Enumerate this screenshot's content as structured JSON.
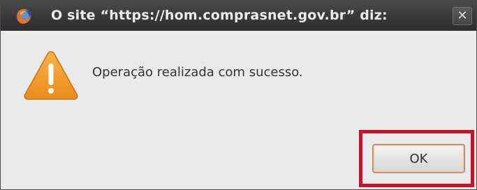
{
  "window": {
    "title": "O site “https://hom.comprasnet.gov.br” diz:",
    "close_glyph": "✕",
    "app_icon": "firefox-icon"
  },
  "dialog": {
    "icon": "warning-icon",
    "message": "Operação realizada com sucesso.",
    "ok_label": "OK"
  },
  "colors": {
    "titlebar": "#3b3b3b",
    "dialog_background": "#eaeaea",
    "highlight": "#c8102e",
    "warning_fill": "#f29b2e"
  }
}
